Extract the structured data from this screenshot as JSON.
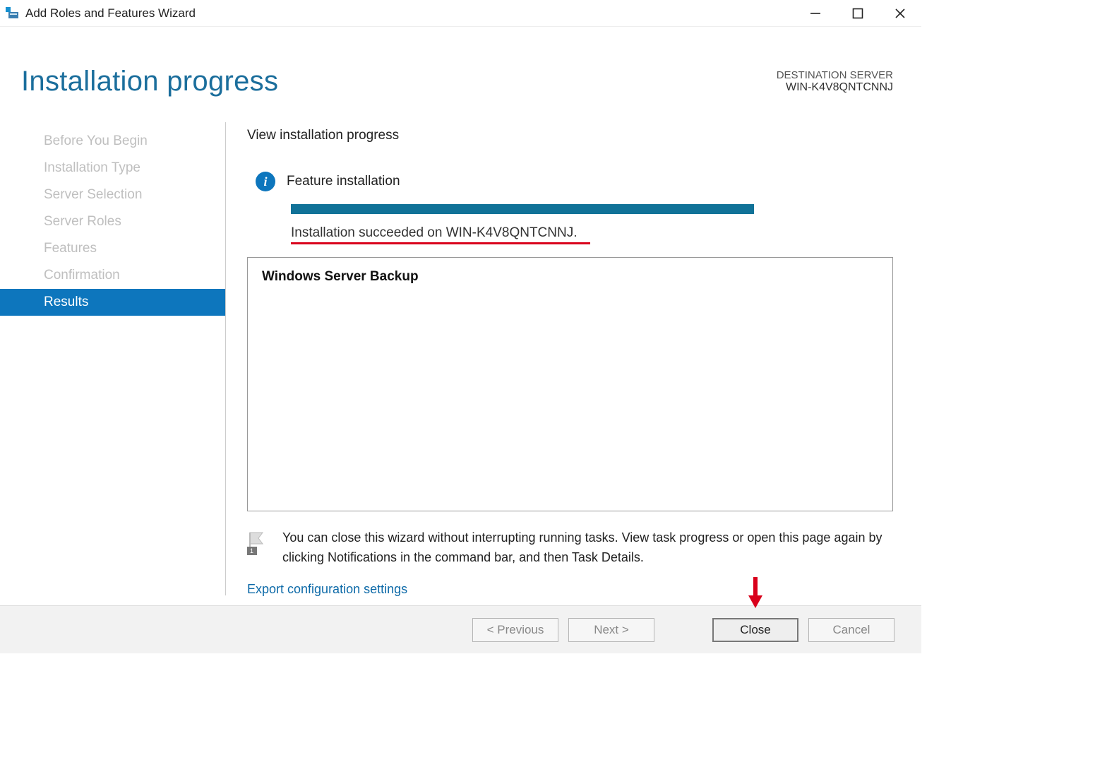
{
  "window": {
    "title": "Add Roles and Features Wizard"
  },
  "header": {
    "page_title": "Installation progress",
    "dest_label": "DESTINATION SERVER",
    "dest_name": "WIN-K4V8QNTCNNJ"
  },
  "sidebar": {
    "items": [
      {
        "label": "Before You Begin",
        "active": false
      },
      {
        "label": "Installation Type",
        "active": false
      },
      {
        "label": "Server Selection",
        "active": false
      },
      {
        "label": "Server Roles",
        "active": false
      },
      {
        "label": "Features",
        "active": false
      },
      {
        "label": "Confirmation",
        "active": false
      },
      {
        "label": "Results",
        "active": true
      }
    ]
  },
  "content": {
    "view_heading": "View installation progress",
    "status_label": "Feature installation",
    "status_message": "Installation succeeded on WIN-K4V8QNTCNNJ.",
    "result_feature": "Windows Server Backup",
    "note_text": "You can close this wizard without interrupting running tasks. View task progress or open this page again by clicking Notifications in the command bar, and then Task Details.",
    "export_link": "Export configuration settings"
  },
  "footer": {
    "previous": "< Previous",
    "next": "Next >",
    "close": "Close",
    "cancel": "Cancel"
  }
}
